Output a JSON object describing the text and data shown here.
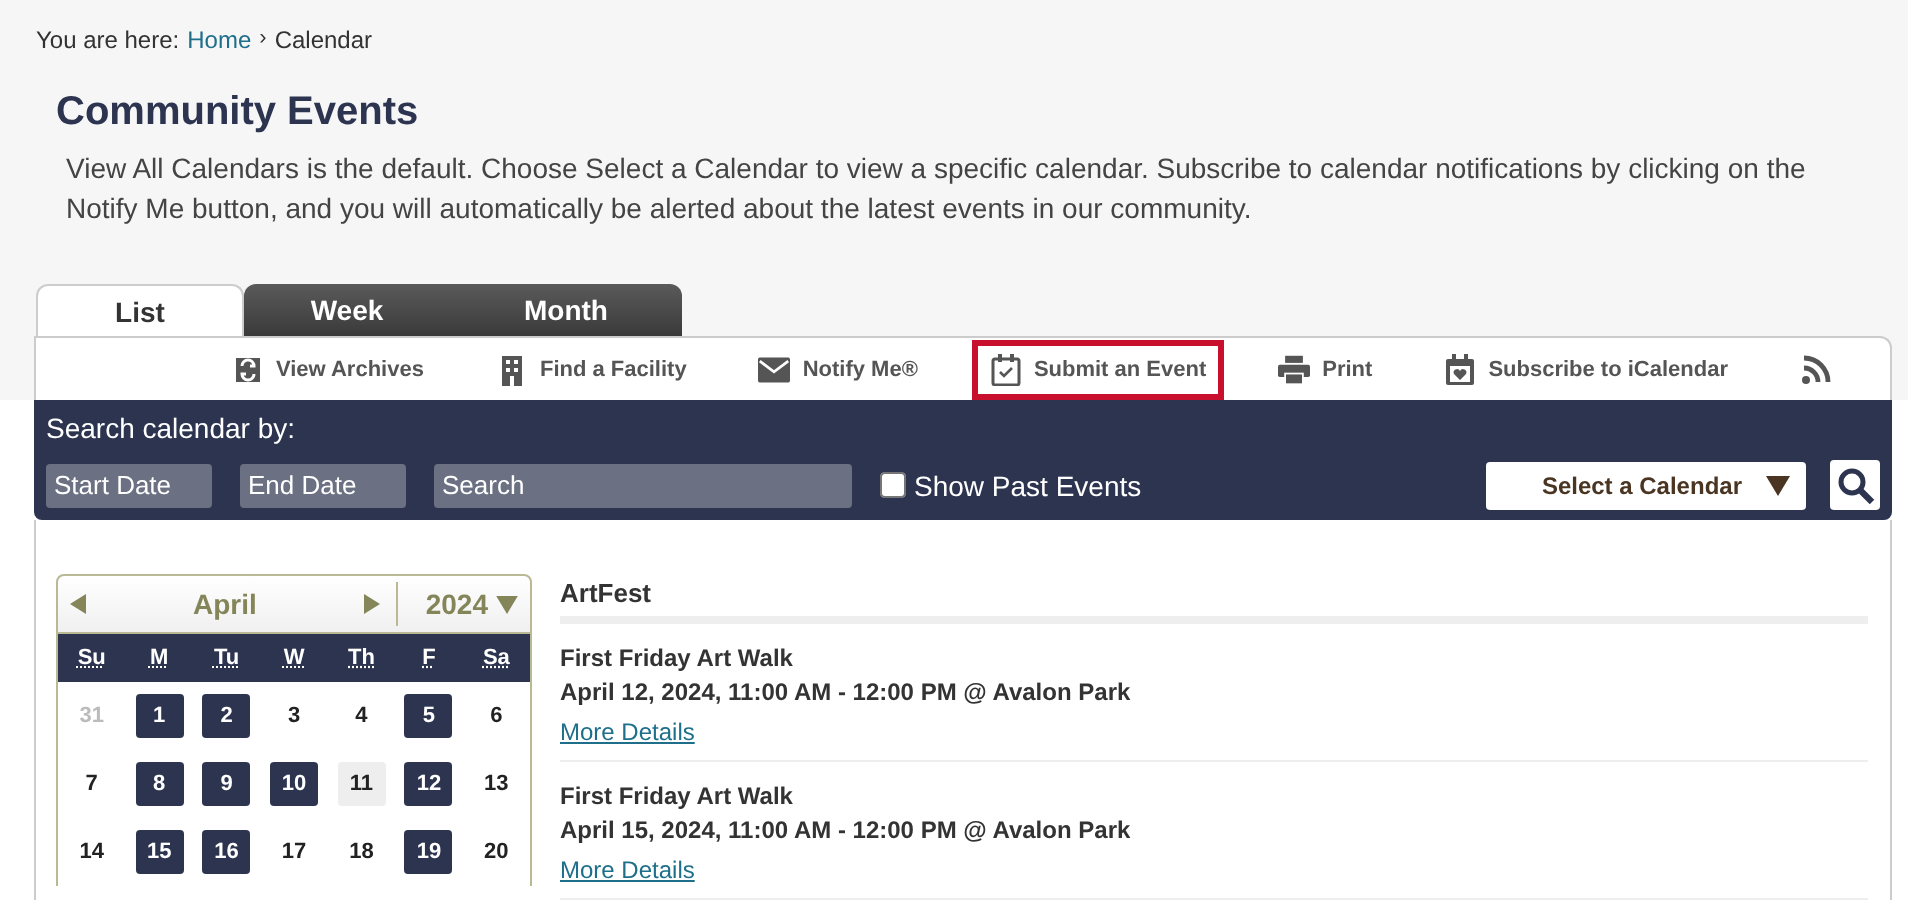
{
  "breadcrumb": {
    "label": "You are here:",
    "links": [
      "Home"
    ],
    "separator": "›",
    "current": "Calendar"
  },
  "page": {
    "title": "Community Events",
    "description": "View All Calendars is the default. Choose Select a Calendar to view a specific calendar. Subscribe to calendar notifications by clicking on the Notify Me button, and you will automatically be alerted about the latest events in our community."
  },
  "tabs": [
    {
      "label": "List",
      "selected": true
    },
    {
      "label": "Week",
      "selected": false
    },
    {
      "label": "Month",
      "selected": false
    }
  ],
  "toolbar": [
    {
      "kind": "archives",
      "label": "View Archives",
      "highlighted": false
    },
    {
      "kind": "facility",
      "label": "Find a Facility",
      "highlighted": false
    },
    {
      "kind": "notify",
      "label": "Notify Me®",
      "highlighted": false
    },
    {
      "kind": "submit",
      "label": "Submit an Event",
      "highlighted": true
    },
    {
      "kind": "print",
      "label": "Print",
      "highlighted": false
    },
    {
      "kind": "subscribe",
      "label": "Subscribe to iCalendar",
      "highlighted": false
    },
    {
      "kind": "rss",
      "highlighted": false
    }
  ],
  "search": {
    "heading": "Search calendar by:",
    "start_date": {
      "placeholder": "Start Date"
    },
    "end_date": {
      "placeholder": "End Date"
    },
    "keyword": {
      "placeholder": "Search"
    },
    "show_past": {
      "label": "Show Past Events",
      "checked": false
    },
    "calendar_select": {
      "label": "Select a Calendar"
    }
  },
  "mini_calendar": {
    "month": "April",
    "year": "2024",
    "weekdays": [
      "Su",
      "M",
      "Tu",
      "W",
      "Th",
      "F",
      "Sa"
    ],
    "weeks": [
      [
        {
          "day": "31",
          "kind": "other"
        },
        {
          "day": "1",
          "kind": "event"
        },
        {
          "day": "2",
          "kind": "event"
        },
        {
          "day": "3",
          "kind": "plain"
        },
        {
          "day": "4",
          "kind": "plain"
        },
        {
          "day": "5",
          "kind": "event"
        },
        {
          "day": "6",
          "kind": "plain"
        }
      ],
      [
        {
          "day": "7",
          "kind": "plain"
        },
        {
          "day": "8",
          "kind": "event"
        },
        {
          "day": "9",
          "kind": "event"
        },
        {
          "day": "10",
          "kind": "event"
        },
        {
          "day": "11",
          "kind": "today"
        },
        {
          "day": "12",
          "kind": "event"
        },
        {
          "day": "13",
          "kind": "plain"
        }
      ],
      [
        {
          "day": "14",
          "kind": "plain"
        },
        {
          "day": "15",
          "kind": "event"
        },
        {
          "day": "16",
          "kind": "event"
        },
        {
          "day": "17",
          "kind": "plain"
        },
        {
          "day": "18",
          "kind": "plain"
        },
        {
          "day": "19",
          "kind": "event"
        },
        {
          "day": "20",
          "kind": "plain"
        }
      ]
    ]
  },
  "events": {
    "calendar_name": "ArtFest",
    "items": [
      {
        "title": "First Friday Art Walk",
        "when": "April 12, 2024, 11:00 AM - 12:00 PM @ Avalon Park",
        "link": "More Details"
      },
      {
        "title": "First Friday Art Walk",
        "when": "April 15, 2024, 11:00 AM - 12:00 PM @ Avalon Park",
        "link": "More Details"
      }
    ]
  }
}
